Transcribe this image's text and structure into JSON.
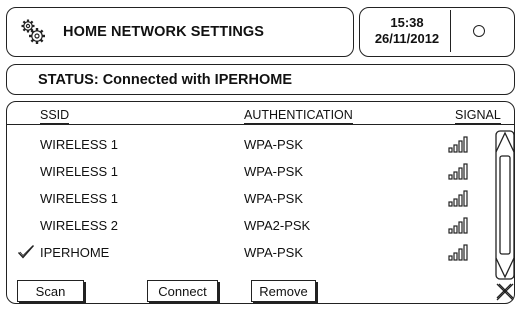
{
  "header": {
    "title": "HOME NETWORK SETTINGS",
    "icon": "gears-icon"
  },
  "clock": {
    "time": "15:38",
    "date": "26/11/2012"
  },
  "status": {
    "text": "STATUS:  Connected with IPERHOME"
  },
  "table": {
    "columns": [
      "SSID",
      "AUTHENTICATION",
      "SIGNAL"
    ],
    "rows": [
      {
        "ssid": "WIRELESS 1",
        "auth": "WPA-PSK",
        "signal_bars": 4,
        "connected": false
      },
      {
        "ssid": "WIRELESS 1",
        "auth": "WPA-PSK",
        "signal_bars": 4,
        "connected": false
      },
      {
        "ssid": "WIRELESS 1",
        "auth": "WPA-PSK",
        "signal_bars": 4,
        "connected": false
      },
      {
        "ssid": "WIRELESS 2",
        "auth": "WPA2-PSK",
        "signal_bars": 4,
        "connected": false
      },
      {
        "ssid": "IPERHOME",
        "auth": "WPA-PSK",
        "signal_bars": 4,
        "connected": true
      }
    ]
  },
  "buttons": {
    "scan": "Scan",
    "connect": "Connect",
    "remove": "Remove"
  },
  "icons": {
    "check": "check-icon",
    "signal": "signal-bars-icon",
    "close": "close-icon",
    "scroll_up": "chevron-up-icon",
    "scroll_down": "chevron-down-icon"
  }
}
